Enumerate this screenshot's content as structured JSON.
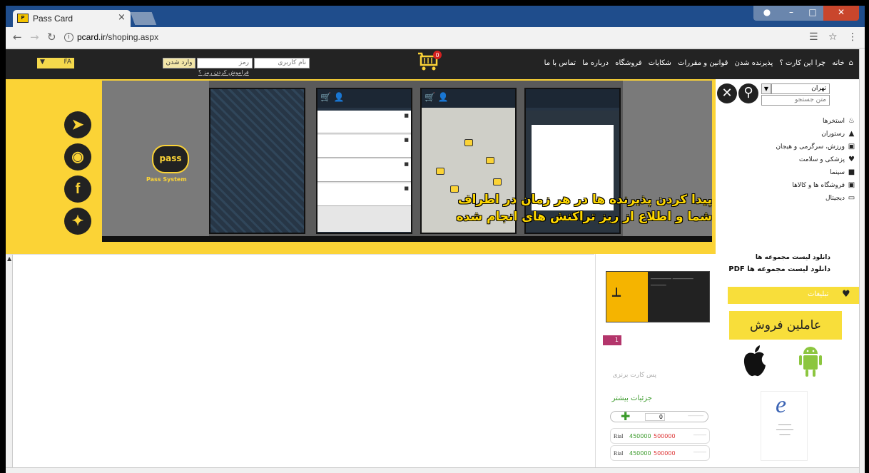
{
  "browser": {
    "tab_title": "Pass Card",
    "tab_close": "×",
    "url_prefix": "pcard.ir",
    "url_path": "/shoping.aspx"
  },
  "topnav": {
    "lang_value": "FA",
    "login_button": "وارد شدن",
    "password_placeholder": "رمز",
    "username_placeholder": "نام کاربری",
    "forgot_link": "فراموش کردن رمز ؟",
    "cart_count": "0",
    "menu": [
      "خانه",
      "چرا این کارت ؟",
      "پذیرنده شدن",
      "قوانین و مقررات",
      "شکایات",
      "فروشگاه",
      "درباره ما",
      "تماس با ما"
    ]
  },
  "sidebar": {
    "city": "تهران",
    "search_placeholder": "متن جستجو",
    "categories": [
      {
        "label": "استخرها",
        "icon": "swimmer-icon"
      },
      {
        "label": "رستوران",
        "icon": "restaurant-icon"
      },
      {
        "label": "ورزش، سرگرمی و هیجان",
        "icon": "cart-icon"
      },
      {
        "label": "پزشکی و سلامت",
        "icon": "heart-icon"
      },
      {
        "label": "سینما",
        "icon": "camera-icon"
      },
      {
        "label": "فروشگاه ها و کالاها",
        "icon": "cart-icon"
      },
      {
        "label": "دیجیتال",
        "icon": "monitor-icon"
      }
    ]
  },
  "banner": {
    "line1": "پیدا کردن پذیرنده ها در هر زمان در اطراف",
    "line2": "شما و اطلاع از ریز تراکنش های انجام شده",
    "pass_logo": "pass",
    "pass_system": "Pass System"
  },
  "product": {
    "card_name": "پس کارت برنزی",
    "more_details": "جزئیات بیشتر",
    "qty_value": "0",
    "price_currency": "Rial",
    "price_new": "450000",
    "price_old": "500000",
    "tag": "1"
  },
  "right": {
    "download1": "دانلود لیست مجموعه ها",
    "download2": "دانلود لیست مجموعه ها PDF",
    "ads_label": "تبلیغات",
    "agents": "عاملین فروش"
  }
}
